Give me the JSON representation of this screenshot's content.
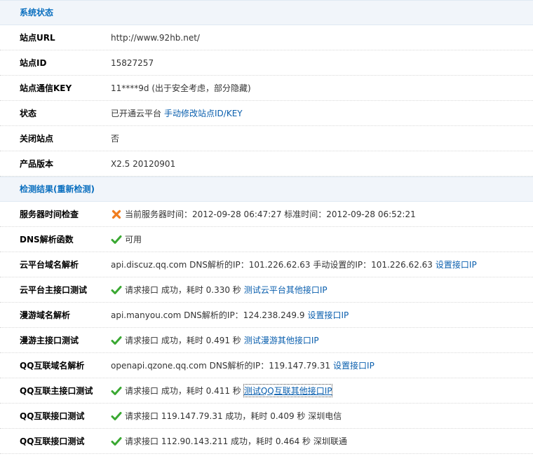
{
  "status": {
    "title": "系统状态",
    "rows": [
      {
        "label": "站点URL",
        "value": "http://www.92hb.net/"
      },
      {
        "label": "站点ID",
        "value": "15827257"
      },
      {
        "label": "站点通信KEY",
        "value": "11****9d (出于安全考虑，部分隐藏)"
      },
      {
        "label": "状态",
        "value": "已开通云平台",
        "link": "手动修改站点ID/KEY"
      },
      {
        "label": "关闭站点",
        "value": "否"
      },
      {
        "label": "产品版本",
        "value": "X2.5 20120901"
      }
    ]
  },
  "check": {
    "title": "检测结果(重新检测)",
    "rows": [
      {
        "label": "服务器时间检查",
        "icon": "error",
        "value": "当前服务器时间：2012-09-28 06:47:27 标准时间：2012-09-28 06:52:21"
      },
      {
        "label": "DNS解析函数",
        "icon": "ok",
        "value": "可用"
      },
      {
        "label": "云平台域名解析",
        "value": "api.discuz.qq.com DNS解析的IP：101.226.62.63 手动设置的IP：101.226.62.63",
        "link": "设置接口IP"
      },
      {
        "label": "云平台主接口测试",
        "icon": "ok",
        "value": "请求接口  成功，耗时  0.330 秒",
        "link": "测试云平台其他接口IP"
      },
      {
        "label": "漫游域名解析",
        "value": "api.manyou.com DNS解析的IP：124.238.249.9",
        "link": "设置接口IP"
      },
      {
        "label": "漫游主接口测试",
        "icon": "ok",
        "value": "请求接口  成功，耗时  0.491 秒",
        "link": "测试漫游其他接口IP"
      },
      {
        "label": "QQ互联域名解析",
        "value": "openapi.qzone.qq.com DNS解析的IP：119.147.79.31",
        "link": "设置接口IP"
      },
      {
        "label": "QQ互联主接口测试",
        "icon": "ok",
        "value": "请求接口  成功，耗时  0.411 秒",
        "link": "测试QQ互联其他接口IP",
        "focused": true
      },
      {
        "label": "QQ互联接口测试",
        "icon": "ok",
        "value": "请求接口  119.147.79.31 成功，耗时  0.409 秒  深圳电信"
      },
      {
        "label": "QQ互联接口测试",
        "icon": "ok",
        "value": "请求接口  112.90.143.211 成功，耗时  0.464 秒  深圳联通"
      }
    ]
  },
  "colors": {
    "ok": "#3aa832",
    "error": "#f07d1e",
    "link": "#0a5fae",
    "head": "#0a6fbf"
  }
}
